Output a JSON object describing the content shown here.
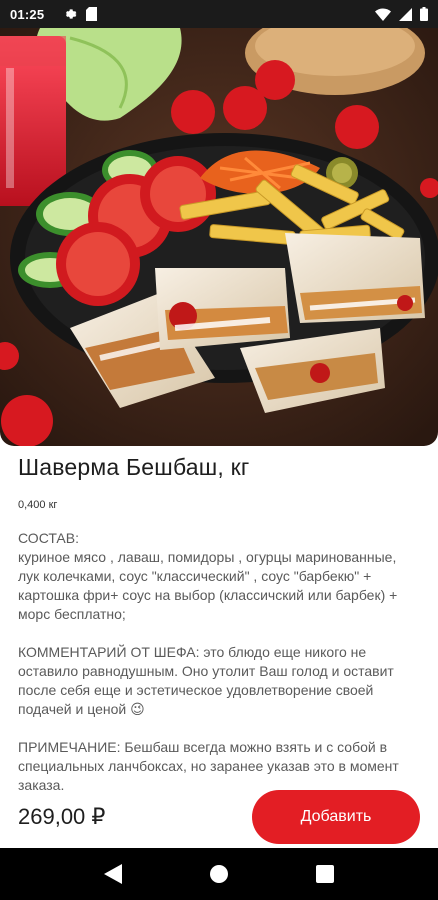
{
  "status_bar": {
    "time": "01:25",
    "icons": [
      "settings-icon",
      "sd-card-icon",
      "wifi-icon",
      "signal-icon",
      "battery-icon"
    ]
  },
  "product": {
    "image": "shawarma-platter-photo",
    "title": "Шаверма Бешбаш, кг",
    "weight": "0,400 кг",
    "description": "СОСТАВ:\nкуриное мясо , лаваш, помидоры , огурцы маринованные, лук колечками, соус \"классический\" , соус \"барбекю\"  + картошка фри+ соус на выбор (классичский или барбек) + морс бесплатно;\n\nКОММЕНТАРИЙ ОТ ШЕФА: это блюдо еще никого не оставило равнодушным. Оно утолит Ваш голод и оставит после себя еще и эстетическое удовлетворение своей подачей и ценой 😉\n\nПРИМЕЧАНИЕ: Бешбаш всегда можно взять и с собой в специальных ланчбоксах, но заранее указав это в момент заказа.",
    "price": "269,00 ₽"
  },
  "actions": {
    "add_label": "Добавить"
  },
  "nav_bar": {
    "buttons": [
      "back-icon",
      "home-icon",
      "recents-icon"
    ]
  },
  "colors": {
    "accent": "#e31e24",
    "status_bar": "#1b1b1b",
    "nav_bar": "#000000"
  }
}
